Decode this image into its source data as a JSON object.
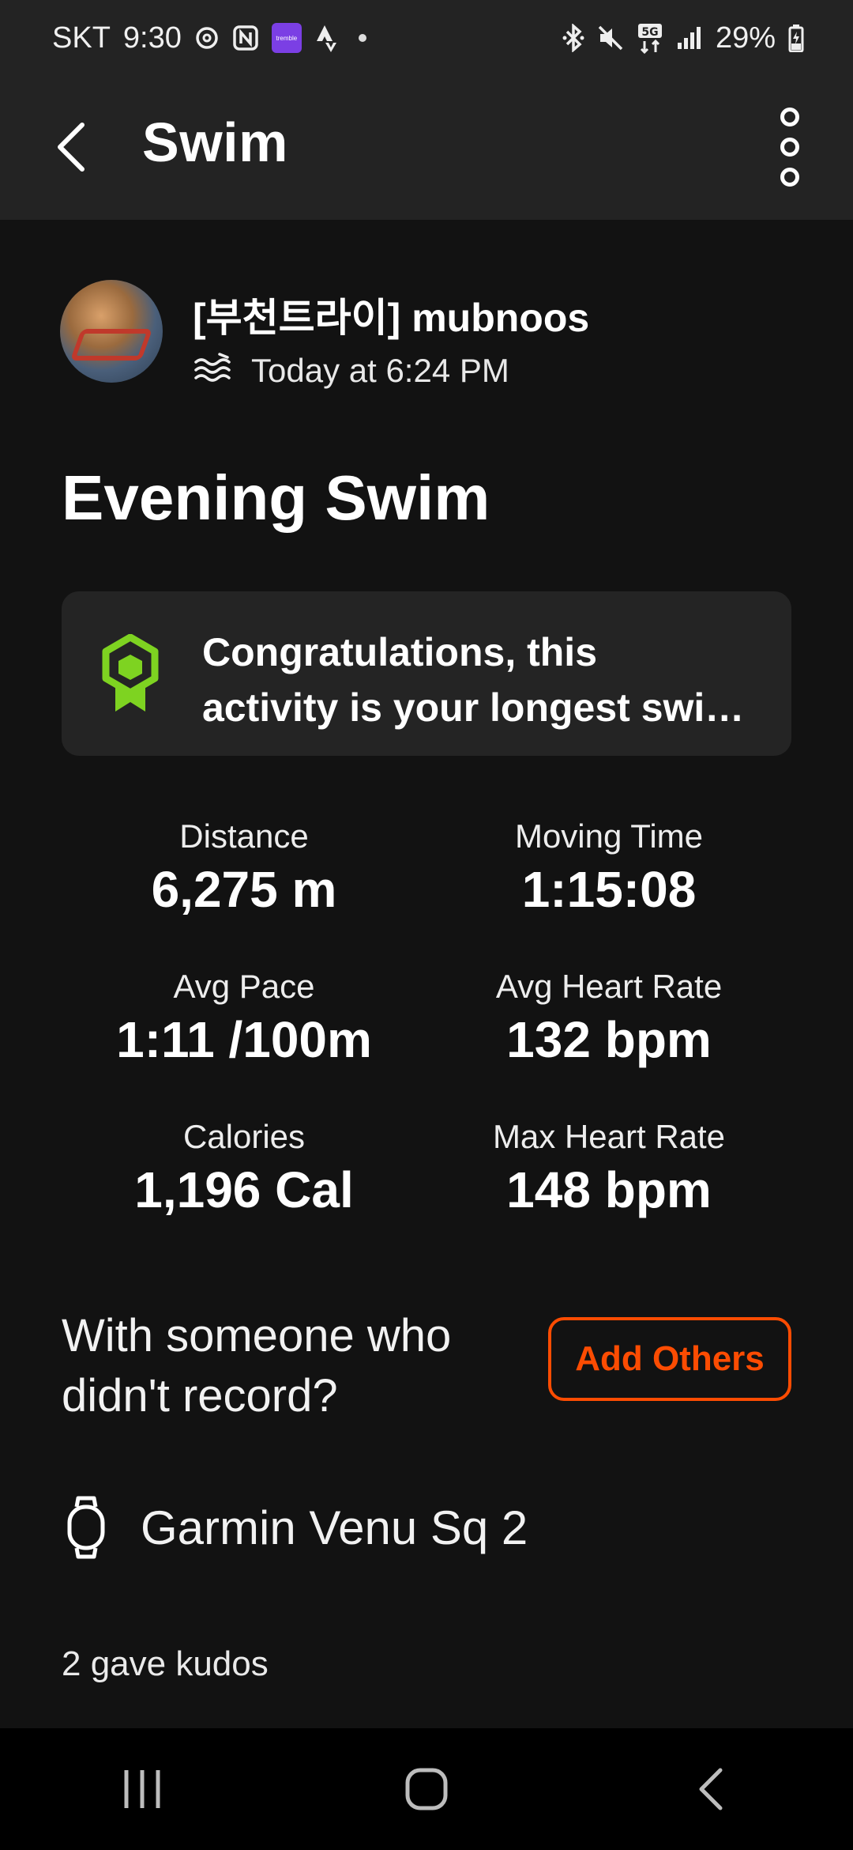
{
  "status_bar": {
    "carrier": "SKT",
    "time": "9:30",
    "app_badge": "tremble",
    "battery": "29%",
    "icons": [
      "threads-icon",
      "nfc-icon",
      "app-badge-icon",
      "strava-icon",
      "bluetooth-icon",
      "mute-icon",
      "5g-icon",
      "signal-icon",
      "battery-icon"
    ]
  },
  "app_bar": {
    "title": "Swim"
  },
  "athlete": {
    "name": "[부천트라이] mubnoos",
    "time": "Today at 6:24 PM",
    "sport_icon": "swim-icon"
  },
  "activity": {
    "title": "Evening Swim",
    "achievement_line1": "Congratulations, this",
    "achievement_line2": "activity is your longest swi…",
    "achievement_color": "#7ed321"
  },
  "stats": [
    {
      "label": "Distance",
      "value": "6,275 m"
    },
    {
      "label": "Moving Time",
      "value": "1:15:08"
    },
    {
      "label": "Avg Pace",
      "value": "1:11 /100m"
    },
    {
      "label": "Avg Heart Rate",
      "value": "132 bpm"
    },
    {
      "label": "Calories",
      "value": "1,196 Cal"
    },
    {
      "label": "Max Heart Rate",
      "value": "148 bpm"
    }
  ],
  "with_others": {
    "line1": "With someone who",
    "line2": "didn't record?",
    "button": "Add Others",
    "accent": "#fc4c02"
  },
  "device": {
    "name": "Garmin Venu Sq 2",
    "icon": "watch-icon"
  },
  "kudos": "2 gave kudos"
}
